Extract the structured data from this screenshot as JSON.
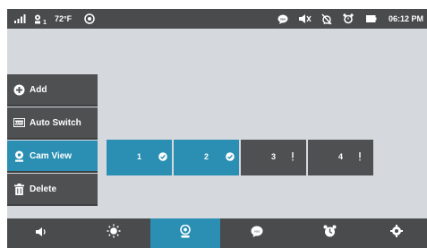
{
  "status_bar": {
    "battery_indicator": "1",
    "temperature": "72°F",
    "time": "06:12 PM",
    "icons": [
      "signal-icon",
      "camera-battery-icon",
      "eye-icon",
      "vox-icon",
      "speaker-mute-icon",
      "alarm-off-icon",
      "alarm-icon",
      "battery-icon"
    ]
  },
  "menu": {
    "items": [
      {
        "label": "Add",
        "icon": "plus-circle-icon"
      },
      {
        "label": "Auto Switch",
        "icon": "auto-switch-icon"
      },
      {
        "label": "Cam View",
        "icon": "camera-icon",
        "active": true
      },
      {
        "label": "Delete",
        "icon": "trash-icon"
      }
    ]
  },
  "cameras": [
    {
      "label": "1",
      "state": "connected",
      "icon": "check-circle-icon"
    },
    {
      "label": "2",
      "state": "connected",
      "icon": "check-circle-icon"
    },
    {
      "label": "3",
      "state": "not-connected",
      "icon": "exclamation-icon"
    },
    {
      "label": "4",
      "state": "not-connected",
      "icon": "exclamation-icon"
    }
  ],
  "bottom_bar": {
    "items": [
      "volume-icon",
      "brightness-icon",
      "camera-icon",
      "vox-icon",
      "alarm-clock-icon",
      "settings-icon"
    ],
    "active": "camera-icon"
  },
  "colors": {
    "accent": "#2a8fb2",
    "bar": "#4a4b4d",
    "background": "#d5d9de",
    "button": "#4f5052"
  }
}
